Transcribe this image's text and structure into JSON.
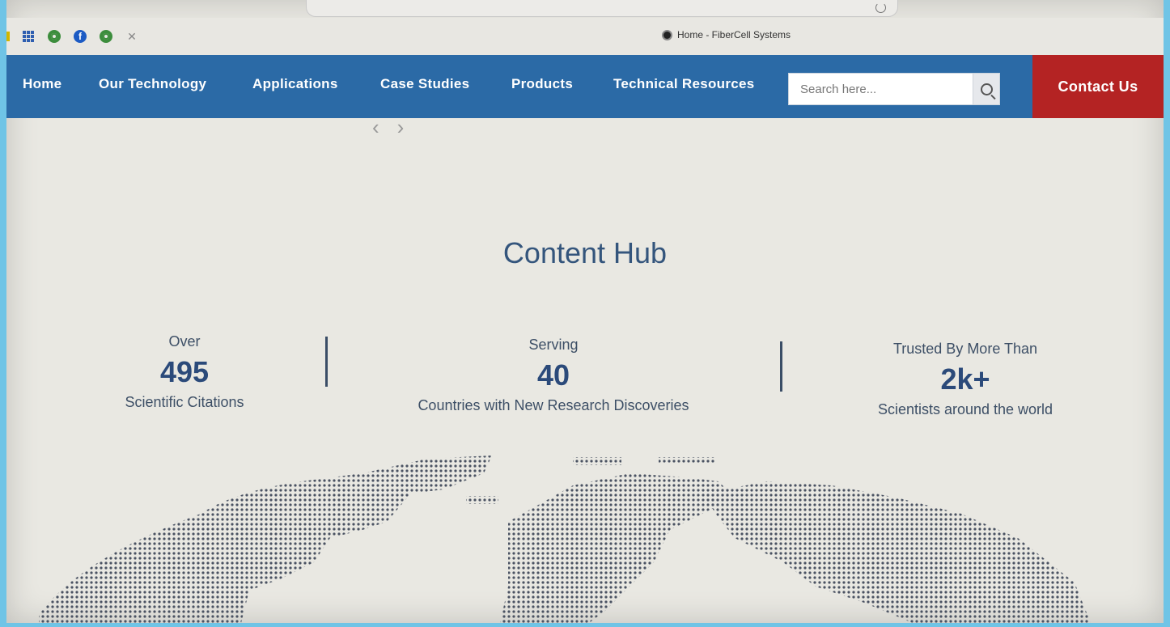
{
  "browser": {
    "tab_title": "Home - FiberCell Systems"
  },
  "nav": {
    "items": [
      "Home",
      "Our Technology",
      "Applications",
      "Case Studies",
      "Products",
      "Technical Resources"
    ],
    "search_placeholder": "Search here...",
    "contact_label": "Contact Us"
  },
  "hub": {
    "title": "Content Hub",
    "stats": [
      {
        "pre": "Over",
        "value": "495",
        "post": "Scientific Citations"
      },
      {
        "pre": "Serving",
        "value": "40",
        "post": "Countries with New Research Discoveries"
      },
      {
        "pre": "Trusted By More Than",
        "value": "2k+",
        "post": "Scientists around the world"
      }
    ]
  },
  "colors": {
    "nav_bg": "#2b6aa6",
    "contact_bg": "#b42323",
    "page_bg": "#e9e8e2",
    "stat_number": "#2b4a7a"
  }
}
